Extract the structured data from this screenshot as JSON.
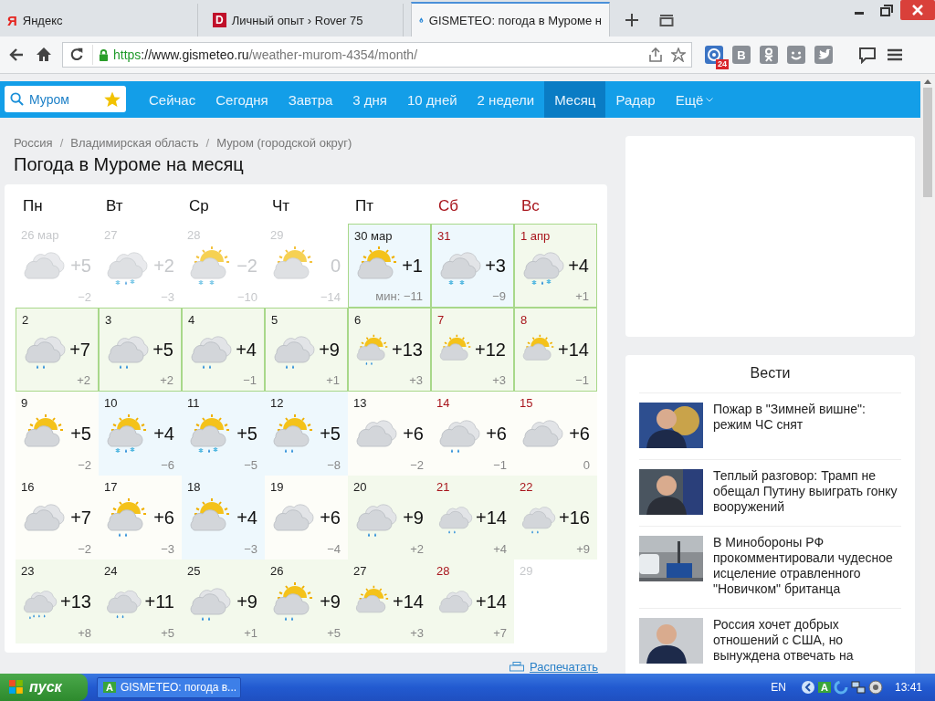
{
  "browser": {
    "tabs": [
      {
        "title": "Яндекс",
        "logo": "Я",
        "kind": "letter",
        "selected": false
      },
      {
        "title": "Личный опыт › Rover 75",
        "logo": "D",
        "kind": "letter_box",
        "selected": false
      },
      {
        "title": "GISMETEO: погода в Муроме н",
        "kind": "drop",
        "selected": true
      }
    ],
    "url": {
      "scheme": "https",
      "host": "://www.gismeteo.ru",
      "path": "/weather-murom-4354/month/"
    },
    "extensions": [
      {
        "kind": "target",
        "badge": "24"
      },
      {
        "kind": "letter",
        "text": "В"
      },
      {
        "kind": "ok"
      },
      {
        "kind": "smile"
      },
      {
        "kind": "bird"
      }
    ]
  },
  "nav": {
    "search": {
      "value": "Муром"
    },
    "items": [
      {
        "label": "Сейчас",
        "selected": false
      },
      {
        "label": "Сегодня",
        "selected": false
      },
      {
        "label": "Завтра",
        "selected": false
      },
      {
        "label": "3 дня",
        "selected": false
      },
      {
        "label": "10 дней",
        "selected": false
      },
      {
        "label": "2 недели",
        "selected": false
      },
      {
        "label": "Месяц",
        "selected": true
      },
      {
        "label": "Радар",
        "selected": false
      }
    ],
    "more": "Ещё"
  },
  "breadcrumbs": [
    {
      "text": "Россия"
    },
    {
      "separator": "/",
      "text": "Владимирская область"
    },
    {
      "separator": "/",
      "text": "Муром (городской округ)"
    }
  ],
  "title": "Погода в Муроме на месяц",
  "calendar": {
    "weekdays": [
      {
        "label": "Пн",
        "weekend": false
      },
      {
        "label": "Вт",
        "weekend": false
      },
      {
        "label": "Ср",
        "weekend": false
      },
      {
        "label": "Чт",
        "weekend": false
      },
      {
        "label": "Пт",
        "weekend": false
      },
      {
        "label": "Сб",
        "weekend": true
      },
      {
        "label": "Вс",
        "weekend": true
      }
    ],
    "days": [
      {
        "date": "26 мар",
        "past": true,
        "color": "#ffffff",
        "outlined": false,
        "weekend": false,
        "kind": "cloudy",
        "high": "+5",
        "low": "−2"
      },
      {
        "date": "27",
        "past": true,
        "color": "#ffffff",
        "outlined": false,
        "weekend": false,
        "kind": "cloudy-sleet",
        "high": "+2",
        "low": "−3"
      },
      {
        "date": "28",
        "past": true,
        "color": "#ffffff",
        "outlined": false,
        "weekend": false,
        "kind": "partly-snow",
        "high": "−2",
        "low": "−10"
      },
      {
        "date": "29",
        "past": true,
        "color": "#ffffff",
        "outlined": false,
        "weekend": false,
        "kind": "partly",
        "high": "0",
        "low": "−14"
      },
      {
        "date": "30 мар",
        "past": false,
        "color": "#eef8fd",
        "outlined": true,
        "weekend": false,
        "kind": "partly",
        "high": "+1",
        "low": "мин: −11"
      },
      {
        "date": "31",
        "past": false,
        "color": "#eef8fd",
        "outlined": true,
        "weekend": true,
        "kind": "cloudy-snow",
        "high": "+3",
        "low": "−9"
      },
      {
        "date": "1 апр",
        "past": false,
        "color": "#f3f9ec",
        "outlined": true,
        "weekend": true,
        "kind": "cloudy-sleet",
        "high": "+4",
        "low": "+1"
      },
      {
        "date": "2",
        "past": false,
        "color": "#f3f9ec",
        "outlined": true,
        "weekend": false,
        "kind": "cloudy-rain",
        "high": "+7",
        "low": "+2"
      },
      {
        "date": "3",
        "past": false,
        "color": "#f3f9ec",
        "outlined": true,
        "weekend": false,
        "kind": "cloudy-rain",
        "high": "+5",
        "low": "+2"
      },
      {
        "date": "4",
        "past": false,
        "color": "#f3f9ec",
        "outlined": true,
        "weekend": false,
        "kind": "cloudy-rain",
        "high": "+4",
        "low": "−1"
      },
      {
        "date": "5",
        "past": false,
        "color": "#f3f9ec",
        "outlined": true,
        "weekend": false,
        "kind": "cloudy-rain",
        "high": "+9",
        "low": "+1"
      },
      {
        "date": "6",
        "past": false,
        "color": "#f3f9ec",
        "outlined": true,
        "weekend": false,
        "kind": "partly-rain",
        "high": "+13",
        "low": "+3"
      },
      {
        "date": "7",
        "past": false,
        "color": "#f3f9ec",
        "outlined": true,
        "weekend": true,
        "kind": "partly",
        "high": "+12",
        "low": "+3"
      },
      {
        "date": "8",
        "past": false,
        "color": "#f3f9ec",
        "outlined": true,
        "weekend": true,
        "kind": "partly",
        "high": "+14",
        "low": "−1"
      },
      {
        "date": "9",
        "past": false,
        "color": "#fdfdf8",
        "outlined": false,
        "weekend": false,
        "kind": "partly",
        "high": "+5",
        "low": "−2"
      },
      {
        "date": "10",
        "past": false,
        "color": "#eef8fd",
        "outlined": false,
        "weekend": false,
        "kind": "partly-sleet",
        "high": "+4",
        "low": "−6"
      },
      {
        "date": "11",
        "past": false,
        "color": "#eef8fd",
        "outlined": false,
        "weekend": false,
        "kind": "partly-sleet",
        "high": "+5",
        "low": "−5"
      },
      {
        "date": "12",
        "past": false,
        "color": "#eef8fd",
        "outlined": false,
        "weekend": false,
        "kind": "partly-rain",
        "high": "+5",
        "low": "−8"
      },
      {
        "date": "13",
        "past": false,
        "color": "#fdfdf8",
        "outlined": false,
        "weekend": false,
        "kind": "cloudy",
        "high": "+6",
        "low": "−2"
      },
      {
        "date": "14",
        "past": false,
        "color": "#fdfdf8",
        "outlined": false,
        "weekend": true,
        "kind": "cloudy-rain",
        "high": "+6",
        "low": "−1"
      },
      {
        "date": "15",
        "past": false,
        "color": "#fdfdf8",
        "outlined": false,
        "weekend": true,
        "kind": "cloudy",
        "high": "+6",
        "low": "0"
      },
      {
        "date": "16",
        "past": false,
        "color": "#fdfdf8",
        "outlined": false,
        "weekend": false,
        "kind": "cloudy",
        "high": "+7",
        "low": "−2"
      },
      {
        "date": "17",
        "past": false,
        "color": "#fdfdf8",
        "outlined": false,
        "weekend": false,
        "kind": "partly-rain",
        "high": "+6",
        "low": "−3"
      },
      {
        "date": "18",
        "past": false,
        "color": "#eef8fd",
        "outlined": false,
        "weekend": false,
        "kind": "partly",
        "high": "+4",
        "low": "−3"
      },
      {
        "date": "19",
        "past": false,
        "color": "#fdfdf8",
        "outlined": false,
        "weekend": false,
        "kind": "cloudy",
        "high": "+6",
        "low": "−4"
      },
      {
        "date": "20",
        "past": false,
        "color": "#f3f9ec",
        "outlined": false,
        "weekend": false,
        "kind": "cloudy-rain",
        "high": "+9",
        "low": "+2"
      },
      {
        "date": "21",
        "past": false,
        "color": "#f3f9ec",
        "outlined": false,
        "weekend": true,
        "kind": "cloudy-rain",
        "high": "+14",
        "low": "+4"
      },
      {
        "date": "22",
        "past": false,
        "color": "#f3f9ec",
        "outlined": false,
        "weekend": true,
        "kind": "cloudy-rain",
        "high": "+16",
        "low": "+9"
      },
      {
        "date": "23",
        "past": false,
        "color": "#f3f9ec",
        "outlined": false,
        "weekend": false,
        "kind": "heavy-rain",
        "high": "+13",
        "low": "+8"
      },
      {
        "date": "24",
        "past": false,
        "color": "#f3f9ec",
        "outlined": false,
        "weekend": false,
        "kind": "cloudy-rain",
        "high": "+11",
        "low": "+5"
      },
      {
        "date": "25",
        "past": false,
        "color": "#f3f9ec",
        "outlined": false,
        "weekend": false,
        "kind": "cloudy-rain",
        "high": "+9",
        "low": "+1"
      },
      {
        "date": "26",
        "past": false,
        "color": "#f3f9ec",
        "outlined": false,
        "weekend": false,
        "kind": "partly-rain",
        "high": "+9",
        "low": "+5"
      },
      {
        "date": "27",
        "past": false,
        "color": "#f3f9ec",
        "outlined": false,
        "weekend": false,
        "kind": "partly",
        "high": "+14",
        "low": "+3"
      },
      {
        "date": "28",
        "past": false,
        "color": "#f3f9ec",
        "outlined": false,
        "weekend": true,
        "kind": "cloudy",
        "high": "+14",
        "low": "+7"
      },
      {
        "date": "29",
        "past": true,
        "color": "#ffffff",
        "outlined": false,
        "weekend": false,
        "kind": "empty"
      }
    ]
  },
  "print_link": "Распечатать",
  "news": {
    "title": "Вести",
    "items": [
      {
        "kind": "picture",
        "text": "Пожар в \"Зимней вишне\": режим ЧС снят"
      },
      {
        "kind": "picture",
        "text": "Теплый разговор: Трамп не обещал Путину выиграть гонку вооружений"
      },
      {
        "kind": "picture",
        "text": "В Минобороны РФ прокомментировали чудесное исцеление отравленного \"Новичком\" британца"
      },
      {
        "kind": "picture",
        "text": "Россия хочет добрых отношений с США, но вынуждена отвечать на"
      }
    ]
  },
  "taskbar": {
    "start": "пуск",
    "task": {
      "logo": "A",
      "label": "GISMETEO: погода в..."
    },
    "language": "EN",
    "tray_logo": "A",
    "time": "13:41"
  }
}
